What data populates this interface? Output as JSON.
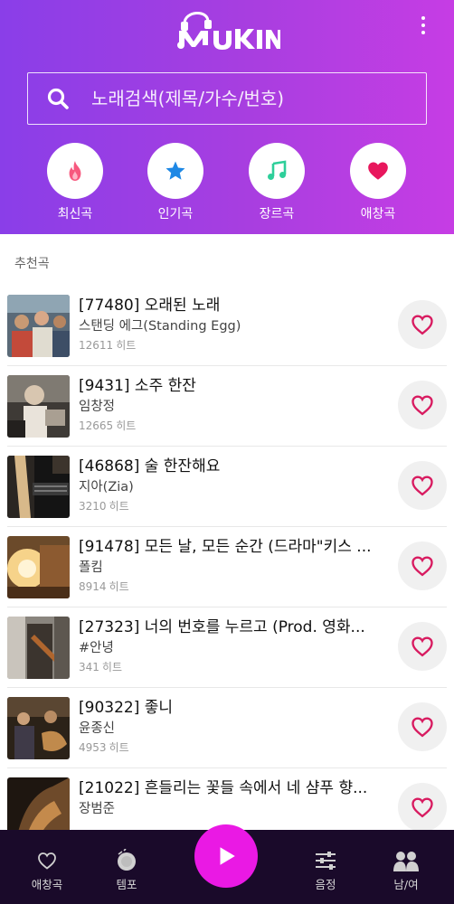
{
  "app": {
    "logo_text": "MUKIN"
  },
  "search": {
    "placeholder": "노래검색(제목/가수/번호)"
  },
  "categories": [
    {
      "label": "최신곡",
      "icon": "fire-icon",
      "color": "#f7587e"
    },
    {
      "label": "인기곡",
      "icon": "star-icon",
      "color": "#1e88e5"
    },
    {
      "label": "장르곡",
      "icon": "music-note-icon",
      "color": "#2ecf9a"
    },
    {
      "label": "애창곡",
      "icon": "heart-icon",
      "color": "#e8175d"
    }
  ],
  "section": {
    "title": "추천곡"
  },
  "songs": [
    {
      "title": "[77480] 오래된 노래",
      "artist": "스탠딩 에그(Standing Egg)",
      "hits": "12611",
      "hits_unit": "히트"
    },
    {
      "title": "[9431] 소주 한잔",
      "artist": "임창정",
      "hits": "12665",
      "hits_unit": "히트"
    },
    {
      "title": "[46868] 술 한잔해요",
      "artist": "지아(Zia)",
      "hits": "3210",
      "hits_unit": "히트"
    },
    {
      "title": "[91478] 모든 날, 모든 순간 (드라마\"키스 ...",
      "artist": "폴킴",
      "hits": "8914",
      "hits_unit": "히트"
    },
    {
      "title": "[27323] 너의 번호를 누르고 (Prod. 영화...",
      "artist": "#안녕",
      "hits": "341",
      "hits_unit": "히트"
    },
    {
      "title": "[90322] 좋니",
      "artist": "윤종신",
      "hits": "4953",
      "hits_unit": "히트"
    },
    {
      "title": "[21022] 흔들리는 꽃들 속에서 네 샴푸 향...",
      "artist": "장범준",
      "hits": "",
      "hits_unit": ""
    }
  ],
  "bottom_nav": {
    "favorites": "애창곡",
    "tempo": "템포",
    "pitch": "음정",
    "gender": "남/여"
  },
  "colors": {
    "header_start": "#8a3ee8",
    "header_end": "#c63de4",
    "accent_pink": "#ea19e4",
    "heart": "#d81b60",
    "nav_bg": "#1a0a2a"
  }
}
